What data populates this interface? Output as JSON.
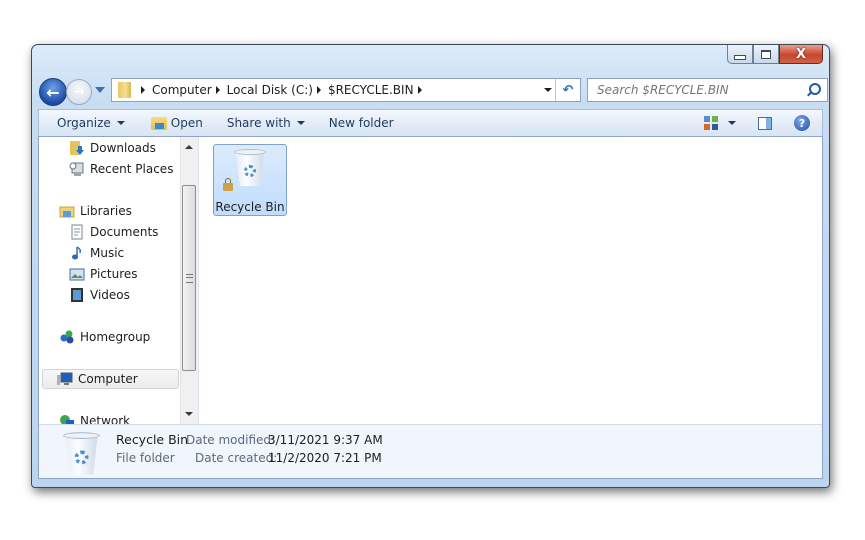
{
  "window": {
    "caption_buttons": {
      "minimize": "minimize",
      "maximize": "maximize",
      "close": "X"
    }
  },
  "address_bar": {
    "crumbs": [
      "Computer",
      "Local Disk (C:)",
      "$RECYCLE.BIN"
    ],
    "refresh_glyph": "↶"
  },
  "search": {
    "placeholder": "Search $RECYCLE.BIN"
  },
  "toolbar": {
    "organize": "Organize",
    "open": "Open",
    "share_with": "Share with",
    "new_folder": "New folder",
    "help": "?"
  },
  "nav_pane": {
    "items": [
      {
        "label": "Downloads",
        "icon": "downloads-folder-icon",
        "indent": 2
      },
      {
        "label": "Recent Places",
        "icon": "recent-places-icon",
        "indent": 2
      },
      {
        "label": "Libraries",
        "icon": "libraries-icon",
        "indent": 1
      },
      {
        "label": "Documents",
        "icon": "documents-icon",
        "indent": 2
      },
      {
        "label": "Music",
        "icon": "music-icon",
        "indent": 2
      },
      {
        "label": "Pictures",
        "icon": "pictures-icon",
        "indent": 2
      },
      {
        "label": "Videos",
        "icon": "videos-icon",
        "indent": 2
      },
      {
        "label": "Homegroup",
        "icon": "homegroup-icon",
        "indent": 1
      },
      {
        "label": "Computer",
        "icon": "computer-icon",
        "indent": 1,
        "selected": true
      },
      {
        "label": "Network",
        "icon": "network-icon",
        "indent": 1
      }
    ]
  },
  "content": {
    "items": [
      {
        "label": "Recycle Bin",
        "icon": "recycle-bin-icon",
        "selected": true,
        "locked": true
      }
    ]
  },
  "details": {
    "name": "Recycle Bin",
    "type": "File folder",
    "modified_label": "Date modified:",
    "modified_value": "3/11/2021 9:37 AM",
    "created_label": "Date created:",
    "created_value": "11/2/2020 7:21 PM"
  }
}
